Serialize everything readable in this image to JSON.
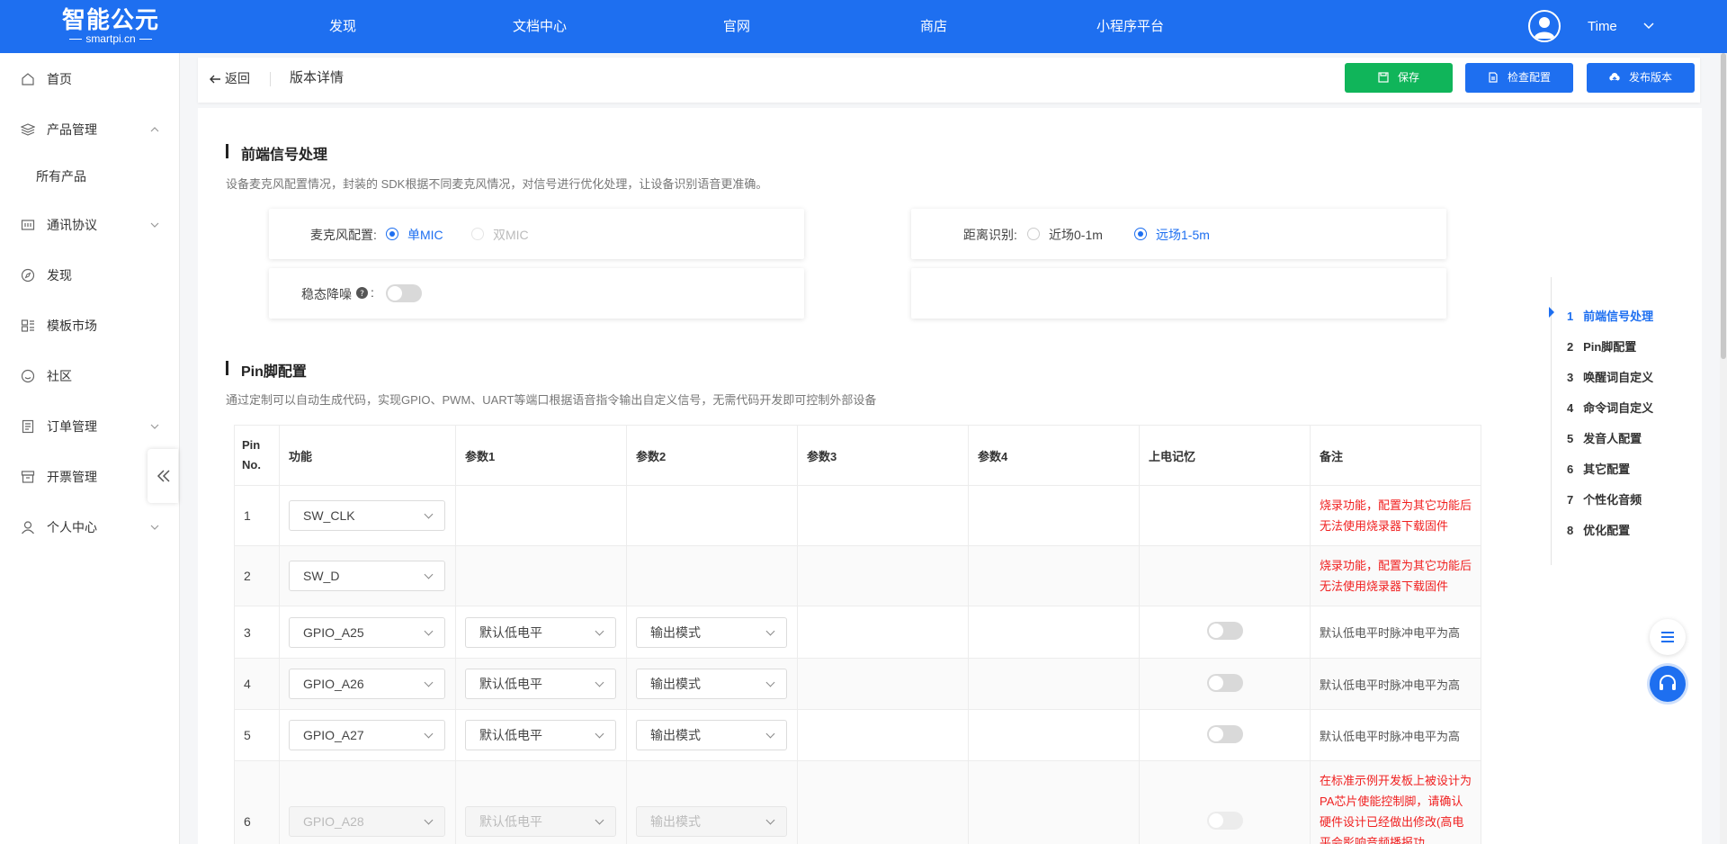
{
  "topbar": {
    "logo_main": "智能公元",
    "logo_sub": "smartpi.cn",
    "nav": [
      "发现",
      "文档中心",
      "官网",
      "商店",
      "小程序平台"
    ],
    "user_name": "Time"
  },
  "sidebar": {
    "items": [
      {
        "label": "首页",
        "icon": "home-icon"
      },
      {
        "label": "产品管理",
        "icon": "layers-icon"
      },
      {
        "label": "通讯协议",
        "icon": "protocol-icon"
      },
      {
        "label": "发现",
        "icon": "compass-icon"
      },
      {
        "label": "模板市场",
        "icon": "template-icon"
      },
      {
        "label": "社区",
        "icon": "smile-icon"
      },
      {
        "label": "订单管理",
        "icon": "order-icon"
      },
      {
        "label": "开票管理",
        "icon": "invoice-icon"
      },
      {
        "label": "个人中心",
        "icon": "user-icon"
      }
    ],
    "sub_item": "所有产品"
  },
  "header": {
    "back_label": "返回",
    "title": "版本详情",
    "save_label": "保存",
    "check_label": "检查配置",
    "publish_label": "发布版本"
  },
  "section1": {
    "title": "前端信号处理",
    "desc": "设备麦克风配置情况，封装的 SDK根据不同麦克风情况，对信号进行优化处理，让设备识别语音更准确。",
    "mic_label": "麦克风配置:",
    "mic_single": "单MIC",
    "mic_dual": "双MIC",
    "distance_label": "距离识别:",
    "distance_near": "近场0-1m",
    "distance_far": "远场1-5m",
    "noise_label": "稳态降噪",
    "noise_colon": ":"
  },
  "section2": {
    "title": "Pin脚配置",
    "desc": "通过定制可以自动生成代码，实现GPIO、PWM、UART等端口根据语音指令输出自定义信号，无需代码开发即可控制外部设备"
  },
  "table": {
    "headers": [
      "Pin No.",
      "功能",
      "参数1",
      "参数2",
      "参数3",
      "参数4",
      "上电记忆",
      "备注"
    ],
    "rows": [
      {
        "pin": "1",
        "func": "SW_CLK",
        "p1": "",
        "p2": "",
        "note": "烧录功能，配置为其它功能后无法使用烧录器下载固件",
        "note_red": true
      },
      {
        "pin": "2",
        "func": "SW_D",
        "p1": "",
        "p2": "",
        "note": "烧录功能，配置为其它功能后无法使用烧录器下载固件",
        "note_red": true
      },
      {
        "pin": "3",
        "func": "GPIO_A25",
        "p1": "默认低电平",
        "p2": "输出模式",
        "note": "默认低电平时脉冲电平为高",
        "note_red": false
      },
      {
        "pin": "4",
        "func": "GPIO_A26",
        "p1": "默认低电平",
        "p2": "输出模式",
        "note": "默认低电平时脉冲电平为高",
        "note_red": false
      },
      {
        "pin": "5",
        "func": "GPIO_A27",
        "p1": "默认低电平",
        "p2": "输出模式",
        "note": "默认低电平时脉冲电平为高",
        "note_red": false
      },
      {
        "pin": "6",
        "func": "GPIO_A28",
        "p1": "默认低电平",
        "p2": "输出模式",
        "note": "在标准示例开发板上被设计为PA芯片使能控制脚，请确认硬件设计已经做出修改(高电平会影响音频播报功",
        "note_red": true
      }
    ]
  },
  "anchor_nav": [
    {
      "num": "1",
      "label": "前端信号处理"
    },
    {
      "num": "2",
      "label": "Pin脚配置"
    },
    {
      "num": "3",
      "label": "唤醒词自定义"
    },
    {
      "num": "4",
      "label": "命令词自定义"
    },
    {
      "num": "5",
      "label": "发音人配置"
    },
    {
      "num": "6",
      "label": "其它配置"
    },
    {
      "num": "7",
      "label": "个性化音频"
    },
    {
      "num": "8",
      "label": "优化配置"
    }
  ],
  "colors": {
    "brand": "#1e6ff0",
    "save": "#10b55a",
    "warning_text": "#f02020"
  }
}
